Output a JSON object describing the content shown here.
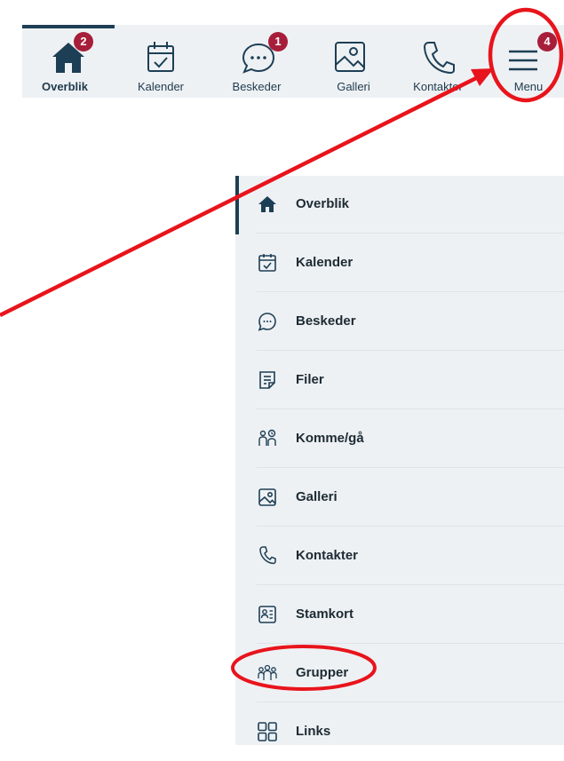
{
  "colors": {
    "accent": "#1d3f55",
    "badge": "#a71e3a",
    "nav_background": "#eef1f4",
    "annotation": "#e8141c"
  },
  "topnav": {
    "items": [
      {
        "label": "Overblik",
        "icon": "home-icon",
        "badge": "2",
        "active": true
      },
      {
        "label": "Kalender",
        "icon": "calendar-icon"
      },
      {
        "label": "Beskeder",
        "icon": "message-icon",
        "badge": "1"
      },
      {
        "label": "Galleri",
        "icon": "gallery-icon"
      },
      {
        "label": "Kontakter",
        "icon": "phone-icon"
      },
      {
        "label": "Menu",
        "icon": "hamburger-icon",
        "badge": "4"
      }
    ]
  },
  "menu": {
    "items": [
      {
        "label": "Overblik",
        "icon": "home-icon",
        "active": true
      },
      {
        "label": "Kalender",
        "icon": "calendar-icon"
      },
      {
        "label": "Beskeder",
        "icon": "message-icon"
      },
      {
        "label": "Filer",
        "icon": "file-icon"
      },
      {
        "label": "Komme/gå",
        "icon": "check-in-icon"
      },
      {
        "label": "Galleri",
        "icon": "gallery-icon"
      },
      {
        "label": "Kontakter",
        "icon": "phone-icon"
      },
      {
        "label": "Stamkort",
        "icon": "id-card-icon"
      },
      {
        "label": "Grupper",
        "icon": "groups-icon"
      },
      {
        "label": "Links",
        "icon": "links-icon"
      }
    ]
  },
  "annotations": {
    "highlight_targets": [
      "Menu",
      "Grupper"
    ]
  }
}
